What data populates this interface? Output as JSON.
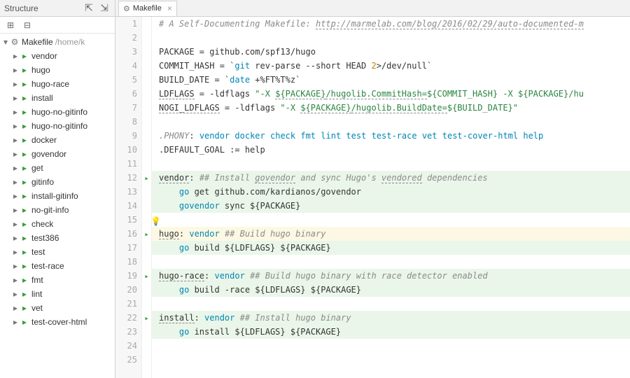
{
  "header": {
    "structure_label": "Structure"
  },
  "tab": {
    "filename": "Makefile"
  },
  "tree": {
    "root_label": "Makefile",
    "root_path": "/home/k",
    "items": [
      "vendor",
      "hugo",
      "hugo-race",
      "install",
      "hugo-no-gitinfo",
      "hugo-no-gitinfo",
      "docker",
      "govendor",
      "get",
      "gitinfo",
      "install-gitinfo",
      "no-git-info",
      "check",
      "test386",
      "test",
      "test-race",
      "fmt",
      "lint",
      "vet",
      "test-cover-html"
    ]
  },
  "run_lines": [
    12,
    16,
    19,
    22
  ],
  "code": [
    {
      "n": 1,
      "cls": "",
      "spans": [
        {
          "t": "# A Self-Documenting Makefile: ",
          "c": "cm"
        },
        {
          "t": "http://marmelab.com/blog/2016/02/29/auto-documented-m",
          "c": "cm und"
        }
      ]
    },
    {
      "n": 2,
      "cls": "",
      "spans": []
    },
    {
      "n": 3,
      "cls": "",
      "spans": [
        {
          "t": "PACKAGE = github.com/spf13/hugo"
        }
      ]
    },
    {
      "n": 4,
      "cls": "",
      "spans": [
        {
          "t": "COMMIT_HASH = `"
        },
        {
          "t": "git",
          "c": "kw"
        },
        {
          "t": " rev-parse --short HEAD "
        },
        {
          "t": "2",
          "c": "num"
        },
        {
          "t": ">/dev/null`"
        }
      ]
    },
    {
      "n": 5,
      "cls": "",
      "spans": [
        {
          "t": "BUILD_DATE = `"
        },
        {
          "t": "date",
          "c": "kw"
        },
        {
          "t": " +%FT%T%z`"
        }
      ]
    },
    {
      "n": 6,
      "cls": "",
      "spans": [
        {
          "t": "LDFLAGS",
          "c": "und"
        },
        {
          "t": " = -ldflags "
        },
        {
          "t": "\"-X ",
          "c": "str"
        },
        {
          "t": "${PACKAGE}",
          "c": "str und"
        },
        {
          "t": "/hugolib.CommitHash=",
          "c": "str und"
        },
        {
          "t": "${COMMIT_HASH}",
          "c": "str"
        },
        {
          "t": " -X ",
          "c": "str"
        },
        {
          "t": "${PACKAGE}",
          "c": "str"
        },
        {
          "t": "/hu",
          "c": "str"
        }
      ]
    },
    {
      "n": 7,
      "cls": "",
      "spans": [
        {
          "t": "NOGI_LDFLAGS",
          "c": "und"
        },
        {
          "t": " = -ldflags "
        },
        {
          "t": "\"-X ",
          "c": "str"
        },
        {
          "t": "${PACKAGE}",
          "c": "str und"
        },
        {
          "t": "/hugolib.BuildDate=",
          "c": "str und"
        },
        {
          "t": "${BUILD_DATE}",
          "c": "str"
        },
        {
          "t": "\"",
          "c": "str"
        }
      ]
    },
    {
      "n": 8,
      "cls": "",
      "spans": []
    },
    {
      "n": 9,
      "cls": "",
      "spans": [
        {
          "t": ".PHONY",
          "c": "cm"
        },
        {
          "t": ": "
        },
        {
          "t": "vendor",
          "c": "kw"
        },
        {
          "t": " "
        },
        {
          "t": "docker",
          "c": "kw"
        },
        {
          "t": " "
        },
        {
          "t": "check",
          "c": "kw"
        },
        {
          "t": " "
        },
        {
          "t": "fmt",
          "c": "kw"
        },
        {
          "t": " "
        },
        {
          "t": "lint",
          "c": "kw"
        },
        {
          "t": " "
        },
        {
          "t": "test",
          "c": "kw"
        },
        {
          "t": " "
        },
        {
          "t": "test-race",
          "c": "kw"
        },
        {
          "t": " "
        },
        {
          "t": "vet",
          "c": "kw"
        },
        {
          "t": " "
        },
        {
          "t": "test-cover-html",
          "c": "kw"
        },
        {
          "t": " "
        },
        {
          "t": "help",
          "c": "kw"
        }
      ]
    },
    {
      "n": 10,
      "cls": "",
      "spans": [
        {
          "t": ".DEFAULT_GOAL := help"
        }
      ]
    },
    {
      "n": 11,
      "cls": "",
      "spans": []
    },
    {
      "n": 12,
      "cls": "hl-green",
      "spans": [
        {
          "t": "vendor",
          "c": "target und"
        },
        {
          "t": ": "
        },
        {
          "t": "## Install ",
          "c": "cm"
        },
        {
          "t": "govendor",
          "c": "cm und"
        },
        {
          "t": " and sync Hugo's ",
          "c": "cm"
        },
        {
          "t": "vendored",
          "c": "cm und"
        },
        {
          "t": " dependencies",
          "c": "cm"
        }
      ]
    },
    {
      "n": 13,
      "cls": "hl-green",
      "spans": [
        {
          "t": "    "
        },
        {
          "t": "go",
          "c": "kw"
        },
        {
          "t": " get github.com/kardianos/govendor"
        }
      ]
    },
    {
      "n": 14,
      "cls": "hl-green",
      "spans": [
        {
          "t": "    "
        },
        {
          "t": "govendor",
          "c": "kw"
        },
        {
          "t": " sync ${PACKAGE}"
        }
      ]
    },
    {
      "n": 15,
      "cls": "",
      "bulb": true,
      "spans": []
    },
    {
      "n": 16,
      "cls": "hl-yellow",
      "spans": [
        {
          "t": "hugo",
          "c": "target und"
        },
        {
          "t": ": "
        },
        {
          "t": "vendor",
          "c": "kw"
        },
        {
          "t": " "
        },
        {
          "t": "## Build hugo binary",
          "c": "cm"
        }
      ]
    },
    {
      "n": 17,
      "cls": "hl-green",
      "spans": [
        {
          "t": "    "
        },
        {
          "t": "go",
          "c": "kw"
        },
        {
          "t": " build ${LDFLAGS} ${PACKAGE}"
        }
      ]
    },
    {
      "n": 18,
      "cls": "",
      "spans": []
    },
    {
      "n": 19,
      "cls": "hl-green",
      "spans": [
        {
          "t": "hugo-race",
          "c": "target und"
        },
        {
          "t": ": "
        },
        {
          "t": "vendor",
          "c": "kw"
        },
        {
          "t": " "
        },
        {
          "t": "## Build hugo binary with race detector enabled",
          "c": "cm"
        }
      ]
    },
    {
      "n": 20,
      "cls": "hl-green",
      "spans": [
        {
          "t": "    "
        },
        {
          "t": "go",
          "c": "kw"
        },
        {
          "t": " build -race ${LDFLAGS} ${PACKAGE}"
        }
      ]
    },
    {
      "n": 21,
      "cls": "",
      "spans": []
    },
    {
      "n": 22,
      "cls": "hl-green",
      "spans": [
        {
          "t": "install",
          "c": "target und"
        },
        {
          "t": ": "
        },
        {
          "t": "vendor",
          "c": "kw"
        },
        {
          "t": " "
        },
        {
          "t": "## Install hugo binary",
          "c": "cm"
        }
      ]
    },
    {
      "n": 23,
      "cls": "hl-green",
      "spans": [
        {
          "t": "    "
        },
        {
          "t": "go",
          "c": "kw"
        },
        {
          "t": " install ${LDFLAGS} ${PACKAGE}"
        }
      ]
    },
    {
      "n": 24,
      "cls": "",
      "spans": []
    },
    {
      "n": 25,
      "cls": "",
      "spans": []
    }
  ]
}
